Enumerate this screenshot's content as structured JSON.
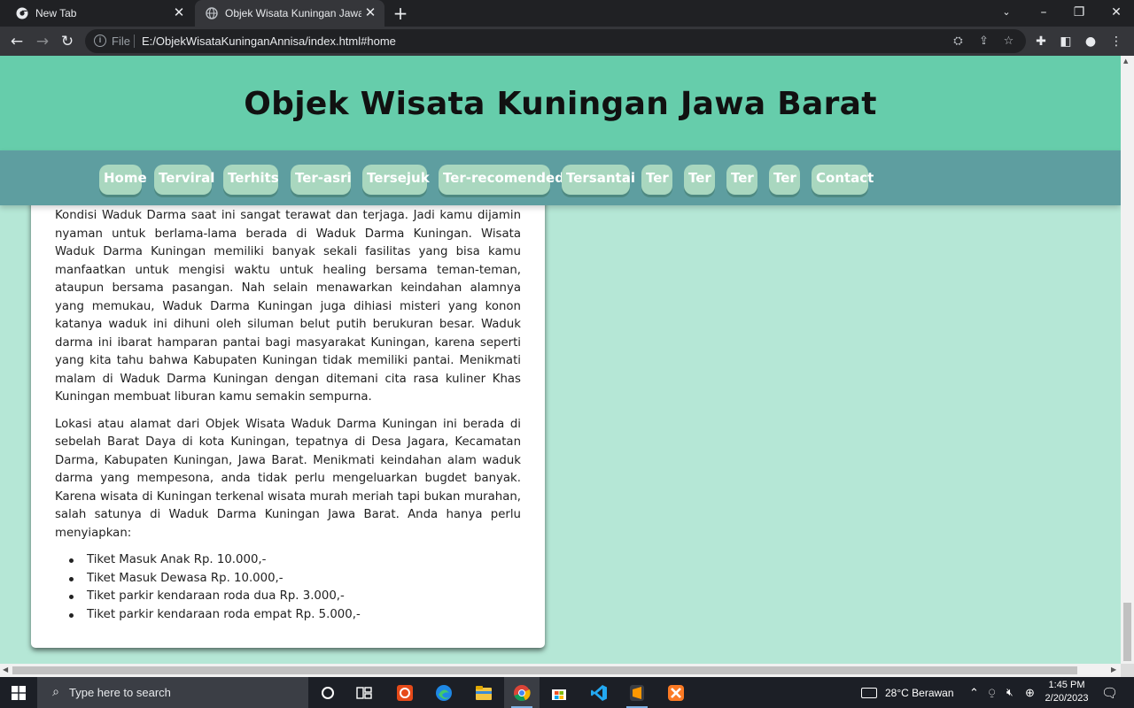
{
  "browser": {
    "tabs": [
      {
        "title": "New Tab"
      },
      {
        "title": "Objek Wisata Kuningan Jawa Barat"
      }
    ],
    "address": {
      "scheme": "File",
      "url": "E:/ObjekWisataKuninganAnnisa/index.html#home"
    }
  },
  "site": {
    "title": "Objek Wisata Kuningan Jawa Barat",
    "nav": [
      "Home",
      "Terviral",
      "Terhits",
      "Ter-asri",
      "Tersejuk",
      "Ter-recomended",
      "Tersantai",
      "Ter",
      "Ter",
      "Ter",
      "Ter",
      "Contact"
    ]
  },
  "article": {
    "paragraphs": [
      "Kondisi Waduk Darma saat ini sangat terawat dan terjaga. Jadi kamu dijamin nyaman untuk berlama-lama berada di Waduk Darma Kuningan. Wisata Waduk Darma Kuningan memiliki banyak sekali fasilitas yang bisa kamu manfaatkan untuk mengisi waktu untuk healing bersama teman-teman, ataupun bersama pasangan. Nah selain menawarkan keindahan alamnya yang memukau, Waduk Darma Kuningan juga dihiasi misteri yang konon katanya waduk ini dihuni oleh siluman belut putih berukuran besar. Waduk darma ini ibarat hamparan pantai bagi masyarakat Kuningan, karena seperti yang kita tahu bahwa Kabupaten Kuningan tidak memiliki pantai. Menikmati malam di Waduk Darma Kuningan dengan ditemani cita rasa kuliner Khas Kuningan membuat liburan kamu semakin sempurna.",
      "Lokasi atau alamat dari Objek Wisata Waduk Darma Kuningan ini berada di sebelah Barat Daya di kota Kuningan, tepatnya di Desa Jagara, Kecamatan Darma, Kabupaten Kuningan, Jawa Barat. Menikmati keindahan alam waduk darma yang mempesona, anda tidak perlu mengeluarkan bugdet banyak. Karena wisata di Kuningan terkenal wisata murah meriah tapi bukan murahan, salah satunya di Waduk Darma Kuningan Jawa Barat. Anda hanya perlu menyiapkan:"
    ],
    "tickets": [
      "Tiket Masuk Anak Rp. 10.000,-",
      "Tiket Masuk Dewasa Rp. 10.000,-",
      "Tiket parkir kendaraan roda dua Rp. 3.000,-",
      "Tiket parkir kendaraan roda empat Rp. 5.000,-"
    ]
  },
  "taskbar": {
    "search_placeholder": "Type here to search",
    "weather": "28°C  Berawan",
    "time": "1:45 PM",
    "date": "2/20/2023"
  },
  "colors": {
    "header": "#66cdab",
    "nav": "#5e9ea0",
    "page_bg": "#b5e7d6",
    "nav_button": "#a9d7bf"
  }
}
